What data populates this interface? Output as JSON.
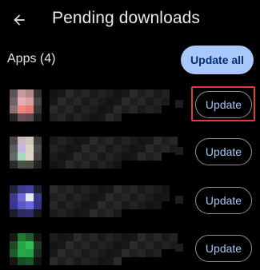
{
  "header": {
    "title": "Pending downloads",
    "back_icon": "arrow-back-icon"
  },
  "section": {
    "title": "Apps (4)",
    "update_all_label": "Update all"
  },
  "apps": [
    {
      "update_label": "Update",
      "highlighted": true,
      "icon_colors": [
        "#5b5458",
        "#c79a9d",
        "#ae8a88",
        "#333133",
        "#6e6264",
        "#e6aeb0",
        "#d9a19e",
        "#494547",
        "#8b7074",
        "#ec8880",
        "#e27a73",
        "#3a3536",
        "#262425",
        "#6a4e50",
        "#5e4a4b",
        "#1f1e1e"
      ]
    },
    {
      "update_label": "Update",
      "highlighted": false,
      "icon_colors": [
        "#484848",
        "#c9b7c7",
        "#cfc5b9",
        "#3b3b3b",
        "#5f5d63",
        "#c7b6e2",
        "#d6d6c4",
        "#4a4a48",
        "#5e6c63",
        "#a7d9bc",
        "#e0d4c7",
        "#3f3f3f",
        "#2b2b2b",
        "#495246",
        "#4b4b45",
        "#222222"
      ]
    },
    {
      "update_label": "Update",
      "highlighted": false,
      "icon_colors": [
        "#22223a",
        "#3e3b8b",
        "#43419a",
        "#1e1e30",
        "#3d3a8d",
        "#6c6cd2",
        "#e6e6f7",
        "#3a388a",
        "#393792",
        "#5a57c9",
        "#6a68d6",
        "#353389",
        "#1c1c2c",
        "#2d2c62",
        "#2e2d66",
        "#17171f"
      ]
    },
    {
      "update_label": "Update",
      "highlighted": false,
      "icon_colors": [
        "#111a13",
        "#1e7a33",
        "#1e5a2a",
        "#121612",
        "#1d4a25",
        "#27a647",
        "#2fbf52",
        "#1d3a22",
        "#1d5d2c",
        "#2aa64a",
        "#25a244",
        "#1a2d1e",
        "#131813",
        "#174f24",
        "#19572a",
        "#101410"
      ]
    }
  ],
  "colors": {
    "background": "#000000",
    "accent": "#a8c7fa",
    "accent_text": "#062e6f",
    "highlight": "#e53935"
  }
}
